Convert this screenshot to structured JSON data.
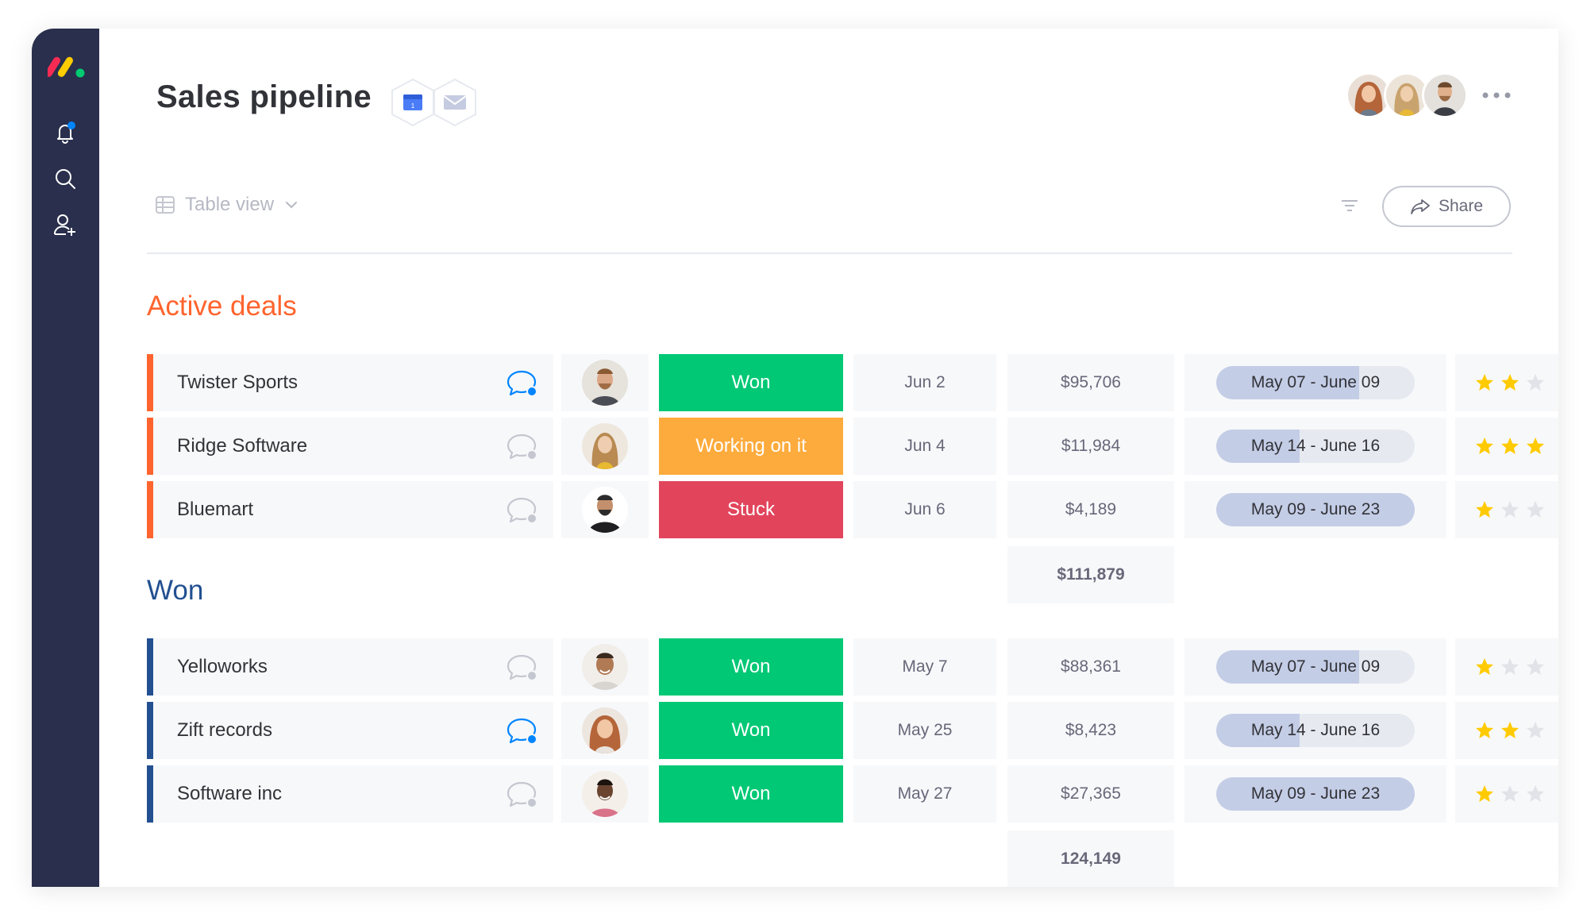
{
  "board": {
    "title": "Sales pipeline",
    "view_label": "Table view",
    "share_label": "Share"
  },
  "colors": {
    "sidebar": "#292f4c",
    "won": "#00c875",
    "working": "#fdab3d",
    "stuck": "#e2445c",
    "active_group": "#ff642e",
    "won_group": "#225091",
    "notification_dot": "#0085ff",
    "star": "#ffcb00"
  },
  "icons": {
    "sidebar": [
      "bell-icon",
      "search-icon",
      "add-user-icon"
    ],
    "header": [
      "calendar-icon",
      "mail-icon",
      "more-icon",
      "table-icon",
      "chevron-down-icon",
      "filter-icon",
      "share-icon"
    ]
  },
  "groups": [
    {
      "title": "Active deals",
      "color": "#ff642e",
      "rows": [
        {
          "name": "Twister Sports",
          "chat_active": true,
          "status": "Won",
          "status_color": "#00c875",
          "date": "Jun 2",
          "value": "$95,706",
          "timeline": "May 07 - June 09",
          "timeline_progress": 0.72,
          "rating": 2
        },
        {
          "name": "Ridge Software",
          "chat_active": false,
          "status": "Working on it",
          "status_color": "#fdab3d",
          "date": "Jun 4",
          "value": "$11,984",
          "timeline": "May 14 - June 16",
          "timeline_progress": 0.42,
          "rating": 3
        },
        {
          "name": "Bluemart",
          "chat_active": false,
          "status": "Stuck",
          "status_color": "#e2445c",
          "date": "Jun 6",
          "value": "$4,189",
          "timeline": "May 09 - June 23",
          "timeline_progress": 1.0,
          "rating": 1
        }
      ],
      "total": "$111,879"
    },
    {
      "title": "Won",
      "color": "#225091",
      "rows": [
        {
          "name": "Yelloworks",
          "chat_active": false,
          "status": "Won",
          "status_color": "#00c875",
          "date": "May 7",
          "value": "$88,361",
          "timeline": "May 07 - June 09",
          "timeline_progress": 0.72,
          "rating": 1
        },
        {
          "name": "Zift records",
          "chat_active": true,
          "status": "Won",
          "status_color": "#00c875",
          "date": "May 25",
          "value": "$8,423",
          "timeline": "May 14 - June 16",
          "timeline_progress": 0.42,
          "rating": 2
        },
        {
          "name": "Software inc",
          "chat_active": false,
          "status": "Won",
          "status_color": "#00c875",
          "date": "May 27",
          "value": "$27,365",
          "timeline": "May 09 - June 23",
          "timeline_progress": 1.0,
          "rating": 1
        }
      ],
      "total": "124,149"
    }
  ]
}
